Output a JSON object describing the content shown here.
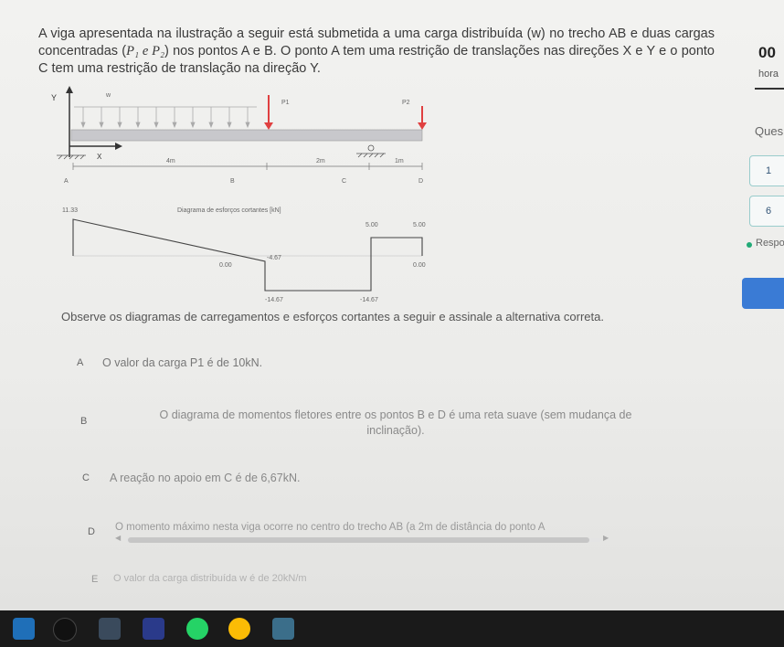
{
  "question": {
    "before": "A viga apresentada na ilustração a seguir está submetida a uma carga distribuída (w) no trecho AB e duas cargas concentradas (",
    "math": "P₁ e P₂",
    "after": ") nos pontos A e B. O ponto A tem uma restrição de translações nas direções X e Y e o ponto C tem uma restrição de translação na direção Y."
  },
  "beam": {
    "y_label": "Y",
    "x_label": "X",
    "w_label": "w",
    "p1_label": "P1",
    "p2_label": "P2",
    "dim_ab": "4m",
    "dim_bc": "2m",
    "dim_cd": "1m",
    "points": [
      "A",
      "B",
      "C",
      "D"
    ]
  },
  "shear": {
    "title": "Diagrama de esforços cortantes [kN]",
    "v_start": "11.33",
    "zero_left": "0.00",
    "v_b_minus": "-4.67",
    "v_b_plus": "-14.67",
    "v_c_minus": "-14.67",
    "v_c_plus": "5.00",
    "v_d_minus": "5.00",
    "zero_right": "0.00"
  },
  "instruction": "Observe os diagramas de carregamentos e esforços cortantes a seguir e assinale a alternativa correta.",
  "alternatives": [
    {
      "letter": "A",
      "text": "O valor da carga P1 é de 10kN."
    },
    {
      "letter": "B",
      "text": "O diagrama de momentos fletores entre os pontos B e D é uma reta suave (sem mudança de inclinação)."
    },
    {
      "letter": "C",
      "text": "A reação no apoio em C é de 6,67kN."
    },
    {
      "letter": "D",
      "text": "O momento máximo nesta viga ocorre no centro do trecho AB (a 2m de distância do ponto A"
    },
    {
      "letter": "E",
      "text": "O valor da carga distribuída w é de 20kN/m"
    }
  ],
  "sidebar": {
    "timer_value": "00",
    "timer_label": "hora",
    "questions_label": "Ques",
    "q_items": [
      "1",
      "6"
    ],
    "responded_label": "Respo"
  },
  "colors": {
    "beam": "#c8c8cc",
    "load_arrow": "#e04040",
    "accent_button": "#3a7bd5"
  }
}
